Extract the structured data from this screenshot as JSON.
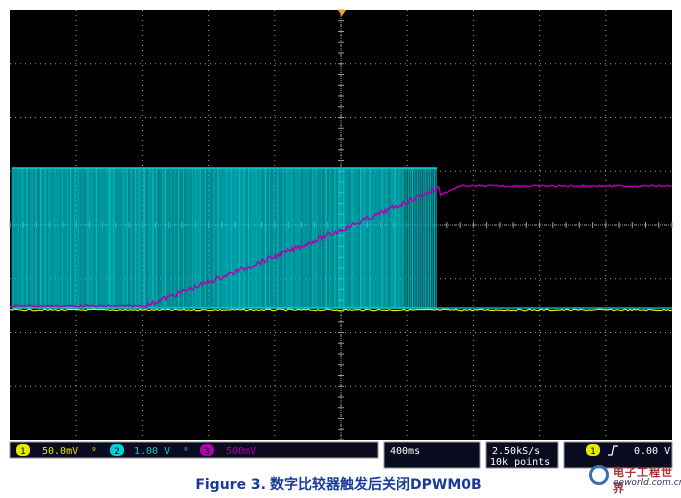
{
  "trigger_marker": "T",
  "status_bar": {
    "ch1": {
      "number": "1",
      "value": "50.0mV",
      "suffix": "⁹",
      "color": "#e8e800"
    },
    "ch2": {
      "number": "2",
      "value": "1.00 V",
      "suffix": "⁹",
      "color": "#00d0d8"
    },
    "ch3": {
      "number": "3",
      "value": "500mV",
      "color": "#b000b0"
    },
    "timebase": "400ms",
    "sample_rate": "2.50kS/s",
    "record_length": "10k points",
    "trigger": {
      "channel": "1",
      "slope_icon": "rising-edge-icon",
      "level": "0.00 V"
    }
  },
  "caption": {
    "label": "Figure 3.",
    "text": "数字比较器触发后关闭DPWM0B"
  },
  "watermark": {
    "cn": "电子工程世界",
    "en": "eeworld.com.cn"
  },
  "colors": {
    "background": "#000000",
    "grid": "#9a9a9a",
    "ch1": "#e8e800",
    "ch2": "#00d0d8",
    "ch3": "#b000b0"
  }
}
